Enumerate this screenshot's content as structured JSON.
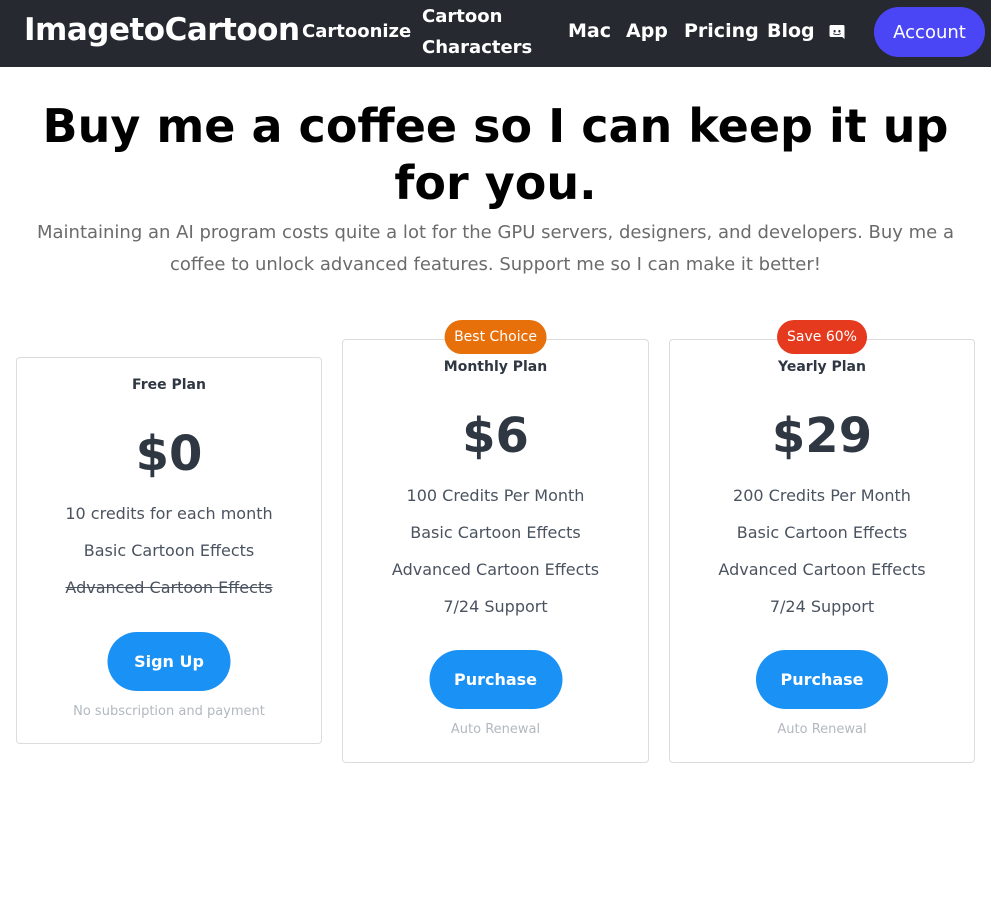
{
  "header": {
    "logo": "ImagetoCartoon",
    "nav": {
      "cartoonize": "Cartoonize",
      "characters": "Cartoon Characters",
      "mac": "Mac",
      "app": "App",
      "pricing": "Pricing",
      "blog": "Blog"
    },
    "discord_icon": "discord-icon",
    "account_label": "Account"
  },
  "hero": {
    "title": "Buy me a coffee so I can keep it up for you.",
    "subtitle": "Maintaining an AI program costs quite a lot for the GPU servers, designers, and developers. Buy me a coffee to unlock advanced features. Support me so I can make it better!"
  },
  "plans": [
    {
      "name": "Free Plan",
      "price": "$0",
      "features": [
        "10 credits for each month",
        "Basic Cartoon Effects",
        "Advanced Cartoon Effects"
      ],
      "struck_feature_index": 2,
      "button": "Sign Up",
      "note": "No subscription and payment"
    },
    {
      "badge": "Best Choice",
      "name": "Monthly Plan",
      "price": "$6",
      "features": [
        "100 Credits Per Month",
        "Basic Cartoon Effects",
        "Advanced Cartoon Effects",
        "7/24 Support"
      ],
      "button": "Purchase",
      "note": "Auto Renewal"
    },
    {
      "badge": "Save 60%",
      "name": "Yearly Plan",
      "price": "$29",
      "features": [
        "200 Credits Per Month",
        "Basic Cartoon Effects",
        "Advanced Cartoon Effects",
        "7/24 Support"
      ],
      "button": "Purchase",
      "note": "Auto Renewal"
    }
  ],
  "colors": {
    "header_bg": "#262a30",
    "account_button": "#4b46f5",
    "plan_button": "#1a91f5",
    "badge_best_choice": "#e8700b",
    "badge_save": "#e53a1e"
  }
}
